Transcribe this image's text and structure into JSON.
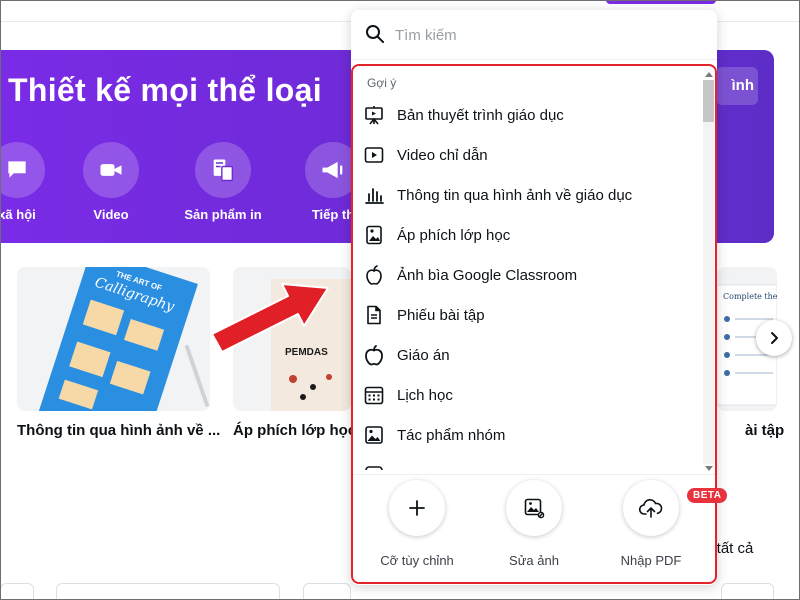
{
  "banner": {
    "title": "Thiết kế mọi thể loại",
    "button_label": "ình",
    "categories": [
      {
        "label": "xã hội",
        "icon": "chat-bubble-icon"
      },
      {
        "label": "Video",
        "icon": "video-camera-icon"
      },
      {
        "label": "Sản phẩm in",
        "icon": "print-products-icon"
      },
      {
        "label": "Tiếp th",
        "icon": "megaphone-icon"
      }
    ]
  },
  "templates": [
    {
      "label": "Thông tin qua hình ảnh về ...",
      "thumb_text": "THE ART OF Calligraphy"
    },
    {
      "label": "Áp phích lớp học",
      "thumb_text": "PEMDAS"
    },
    {
      "label": "ài tập",
      "thumb_text": "Complete the P"
    }
  ],
  "view_all_label": "m tất cả",
  "dropdown": {
    "search_placeholder": "Tìm kiếm",
    "section_title": "Gợi ý",
    "items": [
      {
        "label": "Bản thuyết trình giáo dục",
        "icon": "presentation-board-icon"
      },
      {
        "label": "Video chỉ dẫn",
        "icon": "video-play-icon"
      },
      {
        "label": "Thông tin qua hình ảnh về giáo dục",
        "icon": "bar-chart-icon"
      },
      {
        "label": "Áp phích lớp học",
        "icon": "poster-icon"
      },
      {
        "label": "Ảnh bìa Google Classroom",
        "icon": "apple-icon"
      },
      {
        "label": "Phiếu bài tập",
        "icon": "document-icon"
      },
      {
        "label": "Giáo án",
        "icon": "apple-outline-icon"
      },
      {
        "label": "Lịch học",
        "icon": "calendar-icon"
      },
      {
        "label": "Tác phẩm nhóm",
        "icon": "image-icon"
      }
    ],
    "actions": [
      {
        "label": "Cỡ tùy chỉnh",
        "icon": "plus-icon"
      },
      {
        "label": "Sửa ảnh",
        "icon": "edit-photo-icon"
      },
      {
        "label": "Nhập PDF",
        "icon": "cloud-upload-icon"
      }
    ],
    "beta_badge": "BETA"
  },
  "colors": {
    "brand_purple": "#7d2ae8",
    "highlight_red": "#e5232b",
    "beta_red": "#e8323c"
  }
}
